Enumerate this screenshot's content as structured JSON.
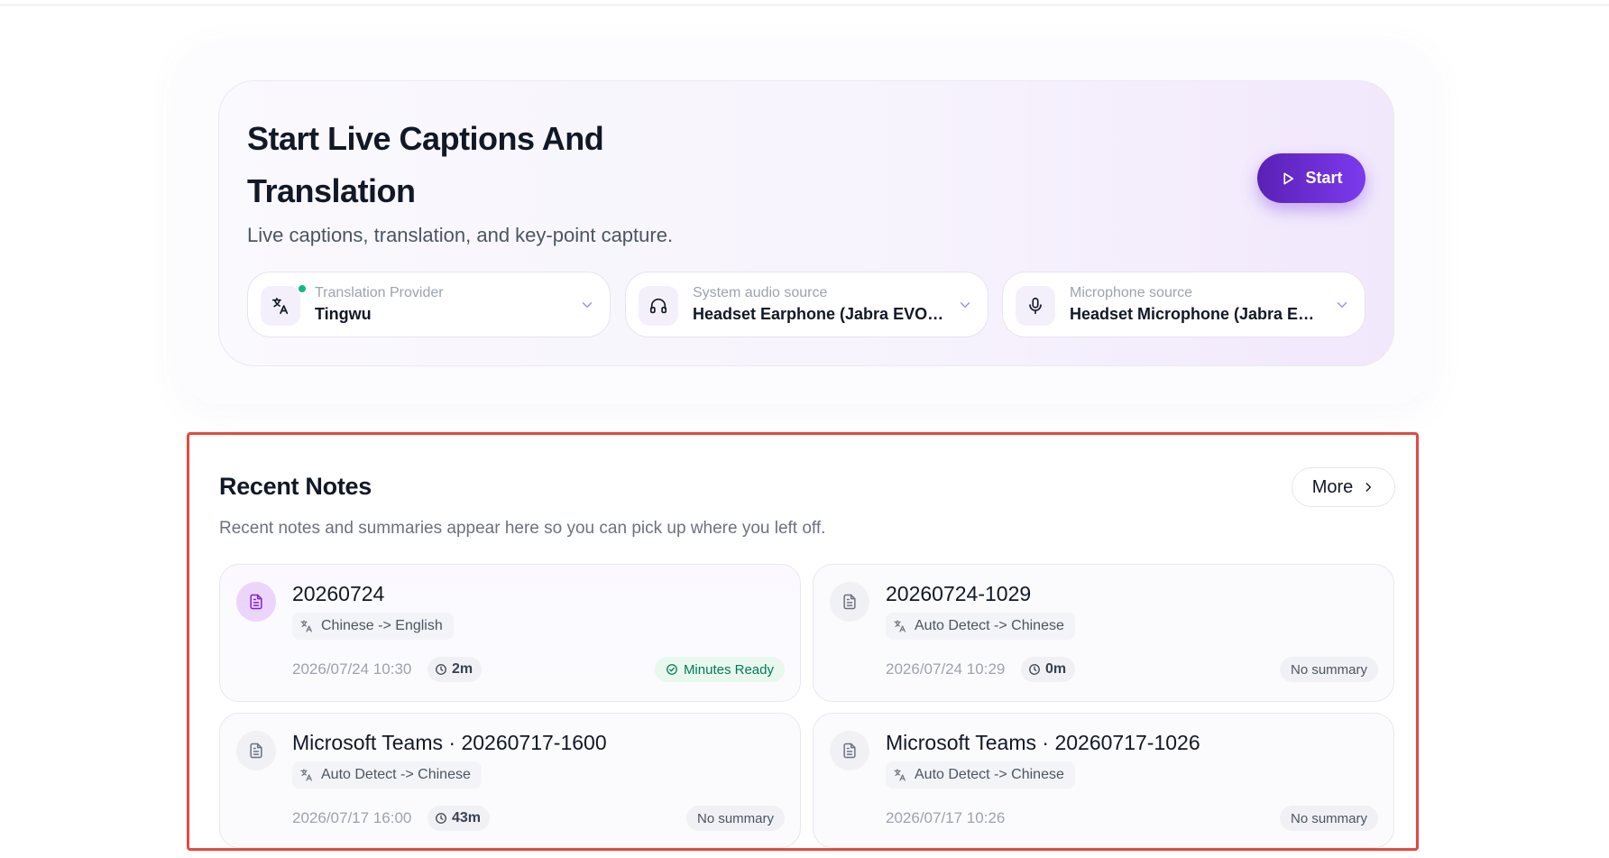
{
  "hero": {
    "title": "Start Live Captions And Translation",
    "subtitle": "Live captions, translation, and key-point capture.",
    "start_label": "Start",
    "selectors": [
      {
        "icon": "translate-icon",
        "label": "Translation Provider",
        "value": "Tingwu",
        "status": "connected"
      },
      {
        "icon": "headphones-icon",
        "label": "System audio source",
        "value": "Headset Earphone (Jabra EVOLV..."
      },
      {
        "icon": "microphone-icon",
        "label": "Microphone source",
        "value": "Headset Microphone (Jabra EVO..."
      }
    ]
  },
  "recent_notes": {
    "title": "Recent Notes",
    "subtitle": "Recent notes and summaries appear here so you can pick up where you left off.",
    "more_label": "More",
    "notes": [
      {
        "title": "20260724",
        "lang": "Chinese -> English",
        "date": "2026/07/24 10:30",
        "duration": "2m",
        "summary": "Minutes Ready",
        "ready": true
      },
      {
        "title": "20260724-1029",
        "lang": "Auto Detect -> Chinese",
        "date": "2026/07/24 10:29",
        "duration": "0m",
        "summary": "No summary",
        "ready": false
      },
      {
        "title": "Microsoft Teams · 20260717-1600",
        "lang": "Auto Detect -> Chinese",
        "date": "2026/07/17 16:00",
        "duration": "43m",
        "summary": "No summary",
        "ready": false
      },
      {
        "title": "Microsoft Teams · 20260717-1026",
        "lang": "Auto Detect -> Chinese",
        "date": "2026/07/17 10:26",
        "duration": "",
        "summary": "No summary",
        "ready": false
      }
    ]
  },
  "colors": {
    "accent": "#6d28d9",
    "highlight_border": "#e5483f",
    "status_green": "#10b981"
  }
}
